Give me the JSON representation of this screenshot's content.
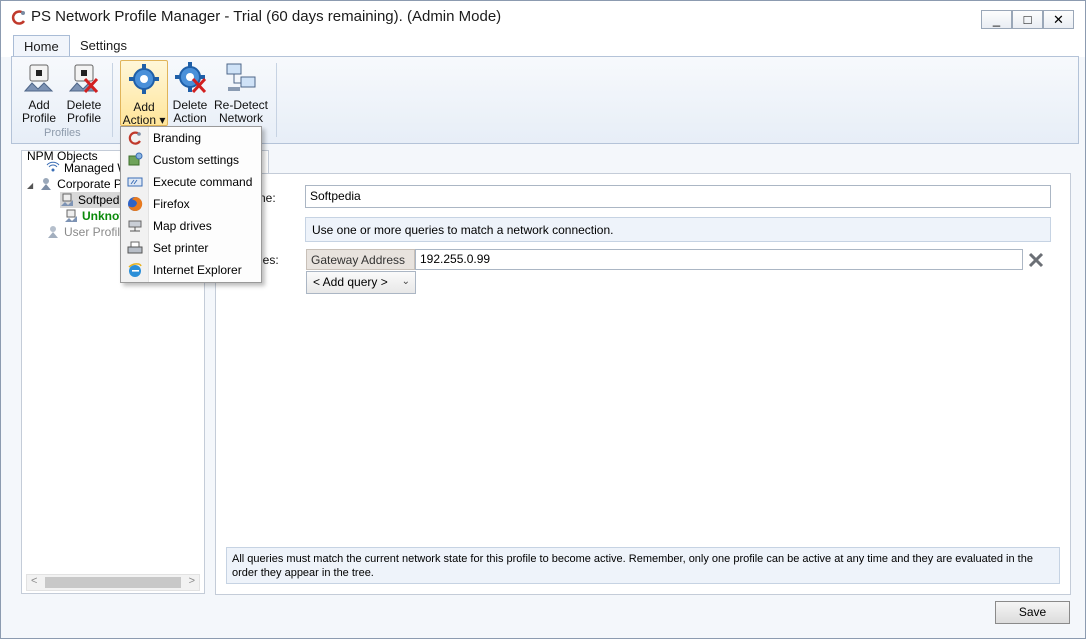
{
  "window": {
    "title": "PS Network Profile Manager - Trial (60 days remaining). (Admin Mode)",
    "minimize_glyph": "_",
    "maximize_glyph": "□",
    "close_glyph": "✕"
  },
  "ribbon": {
    "tabs": [
      {
        "label": "Home",
        "active": true
      },
      {
        "label": "Settings",
        "active": false
      }
    ],
    "buttons": {
      "add_profile": {
        "line1": "Add",
        "line2": "Profile",
        "icon": "add-profile-icon"
      },
      "delete_profile": {
        "line1": "Delete",
        "line2": "Profile",
        "icon": "delete-profile-icon"
      },
      "add_action": {
        "line1": "Add",
        "line2": "Action ▾",
        "icon": "gear-add-icon"
      },
      "delete_action": {
        "line1": "Delete",
        "line2": "Action",
        "icon": "gear-delete-icon"
      },
      "redetect": {
        "line1": "Re-Detect",
        "line2": "Network",
        "icon": "network-computers-icon"
      }
    },
    "group_label": "Profiles"
  },
  "tree": {
    "root": "NPM Objects",
    "items": [
      {
        "label": "Managed W",
        "icon": "wireless-icon"
      },
      {
        "label": "Corporate P",
        "icon": "user-icon"
      },
      {
        "label": "Softpedi",
        "icon": "profile-icon",
        "selected": true
      },
      {
        "label": "Unknov",
        "icon": "profile-icon",
        "color": "#0a8a0a"
      },
      {
        "label": "User Profiles",
        "icon": "user-icon",
        "color": "#8a8a8a"
      }
    ],
    "expander": "◢"
  },
  "menu": {
    "items": [
      {
        "label": "Branding",
        "icon": "branding-icon"
      },
      {
        "label": "Custom settings",
        "icon": "custom-settings-icon"
      },
      {
        "label": "Execute command",
        "icon": "execute-command-icon"
      },
      {
        "label": "Firefox",
        "icon": "firefox-icon"
      },
      {
        "label": "Map drives",
        "icon": "map-drives-icon"
      },
      {
        "label": "Set printer",
        "icon": "printer-icon"
      },
      {
        "label": "Internet Explorer",
        "icon": "ie-icon"
      }
    ]
  },
  "form": {
    "name_label": "ne:",
    "name_value": "Softpedia",
    "info_text": "Use one or more queries to match a network connection.",
    "queries_label": "ries:",
    "query_type": "Gateway Address",
    "query_value": "192.255.0.99",
    "add_query_label": "< Add query >",
    "add_query_chevron": "⌄",
    "note": "All queries must match the current network state for this profile to become active. Remember, only one profile can be active at any time and they are evaluated in the order they appear in the tree."
  },
  "footer": {
    "save_label": "Save"
  },
  "scroll": {
    "left_arrow": "<",
    "right_arrow": ">"
  }
}
